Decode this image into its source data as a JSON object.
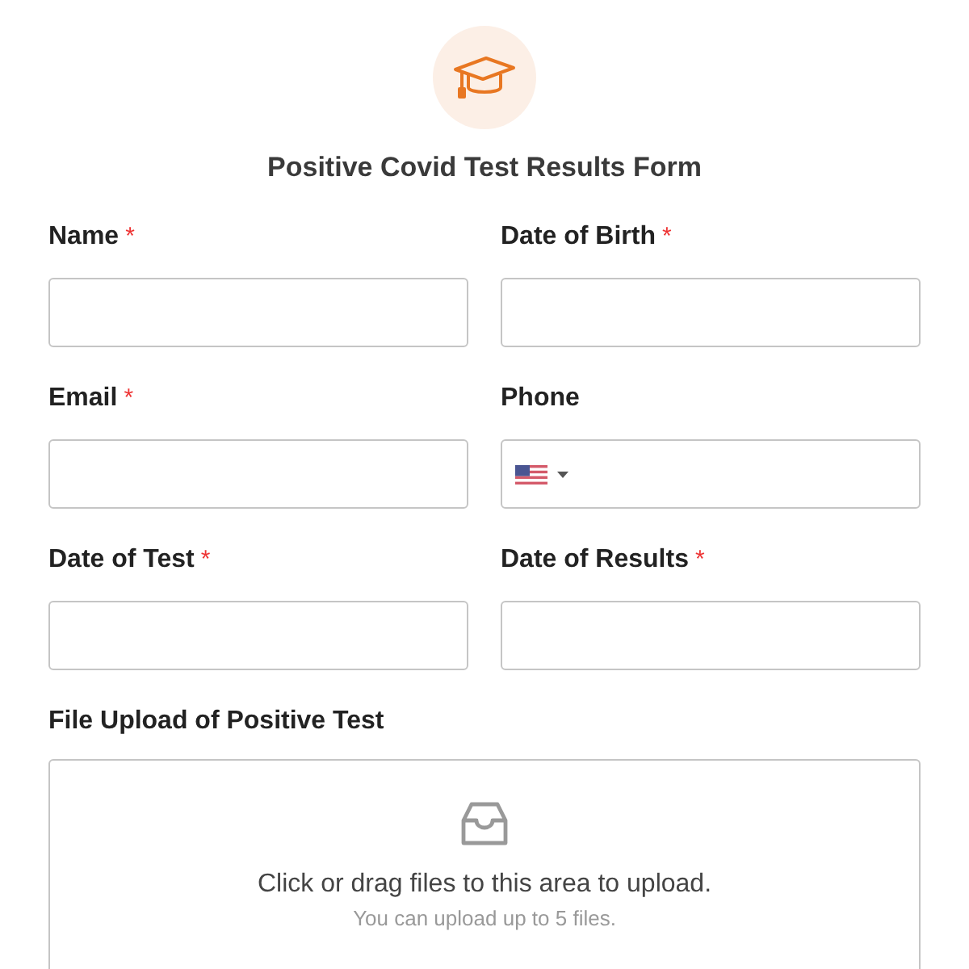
{
  "form": {
    "title": "Positive Covid Test Results Form"
  },
  "fields": [
    {
      "label": "Name",
      "required": true,
      "kind": "text"
    },
    {
      "label": "Date of Birth",
      "required": true,
      "kind": "text"
    },
    {
      "label": "Email",
      "required": true,
      "kind": "text"
    },
    {
      "label": "Phone",
      "required": false,
      "kind": "phone"
    },
    {
      "label": "Date of Test",
      "required": true,
      "kind": "text"
    },
    {
      "label": "Date of Results",
      "required": true,
      "kind": "text"
    }
  ],
  "upload": {
    "label": "File Upload of Positive Test",
    "prompt": "Click or drag files to this area to upload.",
    "hint": "You can upload up to 5 files."
  },
  "required_mark": "*"
}
